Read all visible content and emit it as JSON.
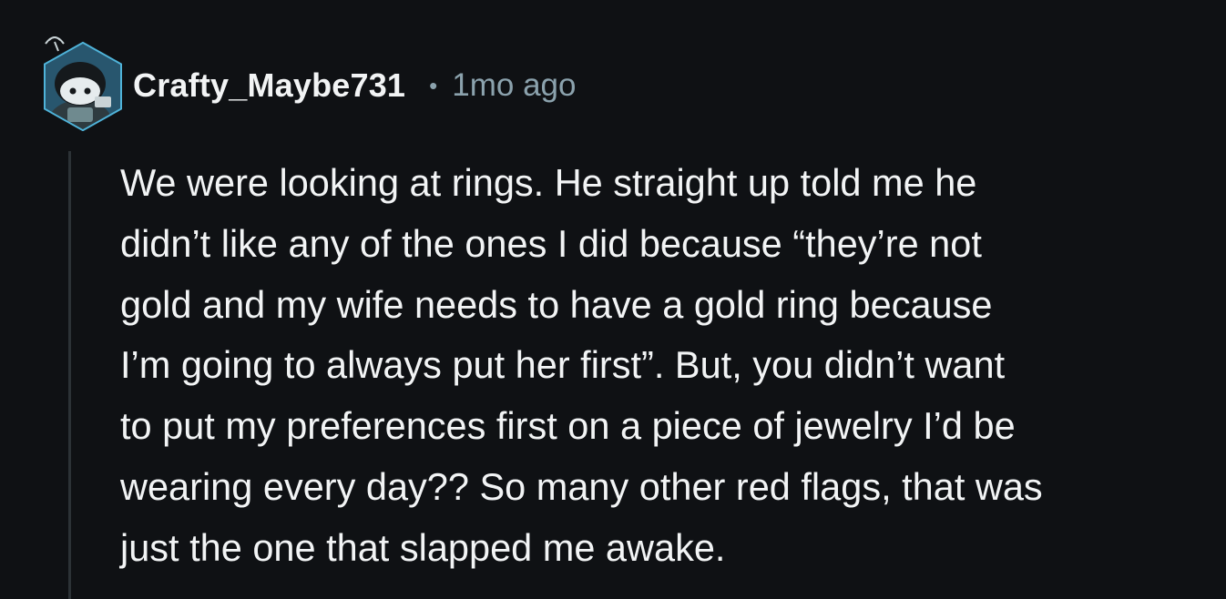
{
  "comment": {
    "author": "Crafty_Maybe731",
    "separator": "•",
    "timestamp": "1mo ago",
    "body_lines": [
      "We were looking at rings. He straight up told me he",
      "didn’t like any of the ones I did because “they’re not",
      "gold and my wife needs to have a gold ring because",
      "I’m going to always put her first”. But, you didn’t want",
      "to put my preferences first on a piece of jewelry I’d be",
      "wearing every day?? So many other red flags, that was",
      "just the one that slapped me awake."
    ]
  },
  "colors": {
    "background": "#0f1114",
    "text_primary": "#f2f4f5",
    "text_meta": "#8ba2ad",
    "thread_line": "#2c3236",
    "avatar_accent": "#4fb3d9"
  },
  "icons": {
    "avatar": "snoo-avatar-icon"
  }
}
